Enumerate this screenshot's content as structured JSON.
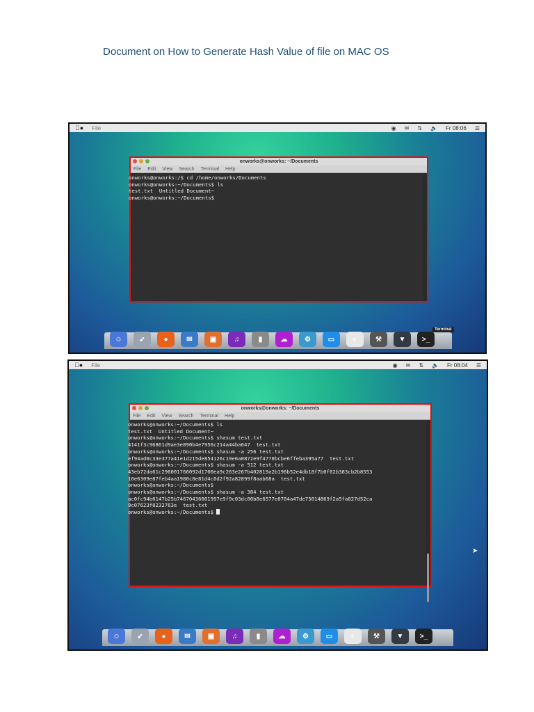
{
  "document": {
    "title": "Document on How to Generate Hash Value of file on MAC OS"
  },
  "screens": [
    {
      "menu_app": "File",
      "clock": "Fr 08:06",
      "terminal": {
        "title": "onworks@onworks: ~/Documents",
        "menu": [
          "File",
          "Edit",
          "View",
          "Search",
          "Terminal",
          "Help"
        ],
        "lines": [
          "onworks@onworks:/$ cd /home/onworks/Documents",
          "onworks@onworks:~/Documents$ ls",
          "test.txt  Untitled Document~",
          "onworks@onworks:~/Documents$"
        ]
      },
      "dock_tooltip": "Terminal"
    },
    {
      "menu_app": "File",
      "clock": "Fr 08:04",
      "terminal": {
        "title": "onworks@onworks: ~/Documents",
        "menu": [
          "File",
          "Edit",
          "View",
          "Search",
          "Terminal",
          "Help"
        ],
        "lines": [
          "onworks@onworks:~/Documents$ ls",
          "test.txt  Untitled Document~",
          "onworks@onworks:~/Documents$ shasum test.txt",
          "4141f3c96861d9ae3e890b4e7956c214a44ba647  test.txt",
          "onworks@onworks:~/Documents$ shasum -a 256 test.txt",
          "ef94ad0c33e377a41e1d215de854126c19e6a0872e9f4770bcbe6ffeba395a77  test.txt",
          "onworks@onworks:~/Documents$ shasum -a 512 test.txt",
          "43eb72da61c296001766092d1700ea9c263e267b402819a2b196b52e4db18f7b0f02b383cb2b8553",
          "16e6309e87feb4aa1980c8e81d4c0d2f92a82899f8aab68a  test.txt",
          "onworks@onworks:~/Documents$",
          "onworks@onworks:~/Documents$ shasum -a 384 test.txt",
          "ac0fc94b6147b25b74670436001997e9f9c03dc00b8e6577e0704a47de75014869f2a5fa827d52ca",
          "9c07623f8232763e  test.txt",
          "onworks@onworks:~/Documents$ "
        ]
      }
    }
  ],
  "dock_icons": [
    {
      "name": "finder-icon",
      "color": "#4a78d8",
      "glyph": "☺"
    },
    {
      "name": "launchpad-icon",
      "color": "#9aa4b0",
      "glyph": "➶"
    },
    {
      "name": "firefox-icon",
      "color": "#e8621c",
      "glyph": "●"
    },
    {
      "name": "thunderbird-icon",
      "color": "#3a7bc8",
      "glyph": "✉"
    },
    {
      "name": "files-icon",
      "color": "#e07030",
      "glyph": "▣"
    },
    {
      "name": "music-icon",
      "color": "#7a2bb8",
      "glyph": "♫"
    },
    {
      "name": "contacts-icon",
      "color": "#8a8a8a",
      "glyph": "▮"
    },
    {
      "name": "cloud-icon",
      "color": "#b020d0",
      "glyph": "☁"
    },
    {
      "name": "software-icon",
      "color": "#3a9ad0",
      "glyph": "⚙"
    },
    {
      "name": "display-icon",
      "color": "#1e8ee8",
      "glyph": "▭"
    },
    {
      "name": "settings-toggle-icon",
      "color": "#e8e8e8",
      "glyph": "◐"
    },
    {
      "name": "system-tool-icon",
      "color": "#555555",
      "glyph": "⚒"
    },
    {
      "name": "trash-icon",
      "color": "#333a44",
      "glyph": "▼"
    },
    {
      "name": "terminal-icon",
      "color": "#222222",
      "glyph": ">_"
    }
  ]
}
